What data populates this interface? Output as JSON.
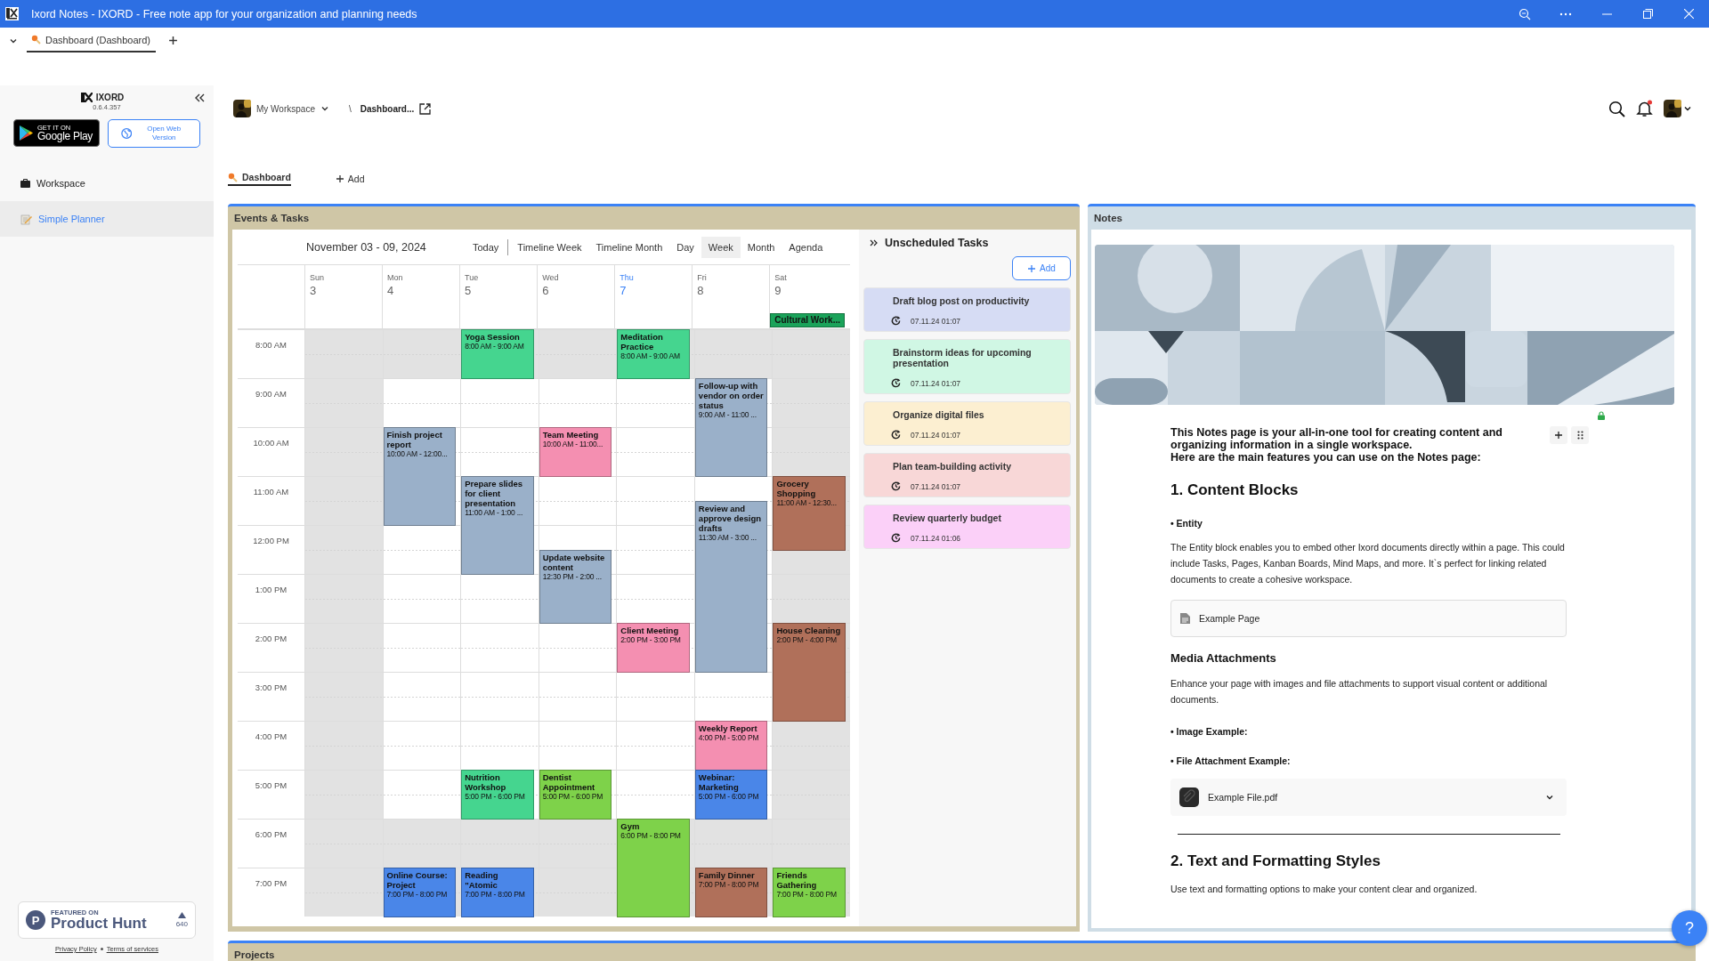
{
  "window": {
    "title": "Ixord Notes - IXORD - Free note app for your organization and planning needs"
  },
  "tab_strip": {
    "tabs": [
      {
        "label": "Dashboard (Dashboard)",
        "selected": true
      }
    ]
  },
  "sidebar": {
    "brand": "IXORD",
    "version": "0.6.4.357",
    "store_badge": {
      "caption": "GET IT ON",
      "name": "Google Play"
    },
    "web_button": "Open Web Version",
    "items": [
      {
        "label": "Workspace",
        "kind": "folder",
        "selected": false
      },
      {
        "label": "Simple Planner",
        "kind": "page",
        "selected": true
      }
    ],
    "product_hunt": {
      "logo": "P",
      "caption": "FEATURED ON",
      "name": "Product Hunt",
      "count": "640"
    },
    "footer_links": [
      "Privacy Policy",
      "Terms of services"
    ]
  },
  "breadcrumb": {
    "workspace": "My Workspace",
    "separator": "\\",
    "page": "Dashboard..."
  },
  "page_tabs": [
    {
      "label": "Dashboard",
      "selected": true
    }
  ],
  "add_page_label": "Add",
  "events_panel": {
    "title": "Events & Tasks",
    "calendar": {
      "range": "November 03 - 09, 2024",
      "today_button": "Today",
      "views": [
        {
          "label": "Timeline Week",
          "selected": false
        },
        {
          "label": "Timeline Month",
          "selected": false
        },
        {
          "label": "Day",
          "selected": false
        },
        {
          "label": "Week",
          "selected": true
        },
        {
          "label": "Month",
          "selected": false
        },
        {
          "label": "Agenda",
          "selected": false
        }
      ],
      "hours": [
        {
          "label": "8:00 AM",
          "work": false
        },
        {
          "label": "9:00 AM",
          "work": true
        },
        {
          "label": "10:00 AM",
          "work": true
        },
        {
          "label": "11:00 AM",
          "work": true
        },
        {
          "label": "12:00 PM",
          "work": true
        },
        {
          "label": "1:00 PM",
          "work": true
        },
        {
          "label": "2:00 PM",
          "work": true
        },
        {
          "label": "3:00 PM",
          "work": true
        },
        {
          "label": "4:00 PM",
          "work": true
        },
        {
          "label": "5:00 PM",
          "work": true
        },
        {
          "label": "6:00 PM",
          "work": false
        },
        {
          "label": "7:00 PM",
          "work": false
        }
      ],
      "days": [
        {
          "name": "Sun",
          "number": "3",
          "today": false,
          "weekend": true
        },
        {
          "name": "Mon",
          "number": "4",
          "today": false,
          "weekend": false,
          "events": [
            {
              "title": "Finish project report",
              "time": "10:00 AM - 12:00...",
              "color": "#9ab0c9"
            },
            {
              "title": "Online Course: Project",
              "time": "7:00 PM - 8:00 PM",
              "color": "#4a86e8"
            }
          ]
        },
        {
          "name": "Tue",
          "number": "5",
          "today": false,
          "weekend": false,
          "events": [
            {
              "title": "Yoga Session",
              "time": "8:00 AM - 9:00 AM",
              "color": "#45d58f"
            },
            {
              "title": "Prepare slides for client presentation",
              "time": "11:00 AM - 1:00 ...",
              "color": "#9ab0c9"
            },
            {
              "title": "Nutrition Workshop",
              "time": "5:00 PM - 6:00 PM",
              "color": "#45d58f"
            },
            {
              "title": "Reading \"Atomic",
              "time": "7:00 PM - 8:00 PM",
              "color": "#4a86e8"
            }
          ]
        },
        {
          "name": "Wed",
          "number": "6",
          "today": false,
          "weekend": false,
          "events": [
            {
              "title": "Team Meeting",
              "time": "10:00 AM - 11:00...",
              "color": "#f48fb1"
            },
            {
              "title": "Update website content",
              "time": "12:30 PM - 2:00 ...",
              "color": "#9ab0c9"
            },
            {
              "title": "Dentist Appointment",
              "time": "5:00 PM - 6:00 PM",
              "color": "#7ed24a"
            }
          ]
        },
        {
          "name": "Thu",
          "number": "7",
          "today": true,
          "weekend": false,
          "events": [
            {
              "title": "Meditation Practice",
              "time": "8:00 AM - 9:00 AM",
              "color": "#45d58f"
            },
            {
              "title": "Client Meeting",
              "time": "2:00 PM - 3:00 PM",
              "color": "#f48fb1"
            },
            {
              "title": "Gym",
              "time": "6:00 PM - 8:00 PM",
              "color": "#7ed24a"
            }
          ]
        },
        {
          "name": "Fri",
          "number": "8",
          "today": false,
          "weekend": false,
          "events": [
            {
              "title": "Follow-up with vendor on order status",
              "time": "9:00 AM - 11:00 ...",
              "color": "#9ab0c9"
            },
            {
              "title": "Review and approve design drafts",
              "time": "11:30 AM - 3:00 ...",
              "color": "#9ab0c9"
            },
            {
              "title": "Weekly Report",
              "time": "4:00 PM - 5:00 PM",
              "color": "#f48fb1"
            },
            {
              "title": "Webinar: Marketing",
              "time": "5:00 PM - 6:00 PM",
              "color": "#4a86e8"
            },
            {
              "title": "Family Dinner",
              "time": "7:00 PM - 8:00 PM",
              "color": "#b0705a"
            }
          ]
        },
        {
          "name": "Sat",
          "number": "9",
          "today": false,
          "weekend": true,
          "all_day": [
            {
              "title": "Cultural Work...",
              "color": "#1aa35a"
            }
          ],
          "events": [
            {
              "title": "Grocery Shopping",
              "time": "11:00 AM - 12:30...",
              "color": "#b0705a"
            },
            {
              "title": "House Cleaning",
              "time": "2:00 PM - 4:00 PM",
              "color": "#b0705a"
            },
            {
              "title": "Friends Gathering",
              "time": "7:00 PM - 8:00 PM",
              "color": "#7ed24a"
            }
          ]
        }
      ]
    },
    "unscheduled": {
      "title": "Unscheduled Tasks",
      "add_label": "Add",
      "tasks": [
        {
          "title": "Draft blog post on productivity",
          "time": "07.11.24 01:07",
          "color": "#d6dcf4"
        },
        {
          "title": "Brainstorm ideas for upcoming presentation",
          "time": "07.11.24 01:07",
          "color": "#d0f7e4"
        },
        {
          "title": "Organize digital files",
          "time": "07.11.24 01:07",
          "color": "#fcefd1"
        },
        {
          "title": "Plan team-building activity",
          "time": "07.11.24 01:07",
          "color": "#f8d7d7"
        },
        {
          "title": "Review quarterly budget",
          "time": "07.11.24 01:06",
          "color": "#fbd0f8"
        }
      ]
    }
  },
  "notes_panel": {
    "title": "Notes",
    "blocks": [
      {
        "kind": "intro",
        "lines": [
          "This Notes page is your all-in-one tool for creating content and organizing information in a single workspace.",
          "Here are the main features you can use on the Notes page:"
        ]
      },
      {
        "kind": "heading1",
        "text": "1. Content Blocks"
      },
      {
        "kind": "bullet",
        "text": "• Entity"
      },
      {
        "kind": "paragraph",
        "text": "The Entity block enables you to embed other Ixord documents directly within a page. This could include Tasks, Pages, Kanban Boards, Mind Maps, and more. It`s perfect for linking related documents to create a cohesive workspace."
      },
      {
        "kind": "entity",
        "label": "Example Page"
      },
      {
        "kind": "heading3",
        "text": "Media Attachments"
      },
      {
        "kind": "paragraph",
        "text": "Enhance your page with images and file attachments to support visual content or additional documents."
      },
      {
        "kind": "bullet",
        "text": "• Image Example:"
      },
      {
        "kind": "bullet",
        "text": "• File Attachment Example:"
      },
      {
        "kind": "file",
        "label": "Example File.pdf"
      },
      {
        "kind": "divider"
      },
      {
        "kind": "heading1",
        "text": "2. Text and Formatting Styles"
      },
      {
        "kind": "paragraph",
        "text": "Use text and formatting options to make your content clear and organized."
      }
    ]
  },
  "projects_panel": {
    "title": "Projects"
  },
  "help_button": "?"
}
